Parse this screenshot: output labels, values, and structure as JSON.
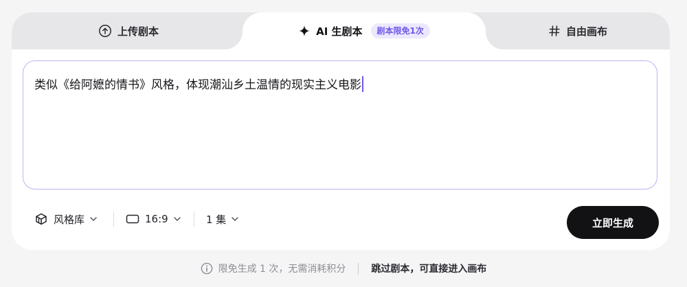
{
  "tabs": {
    "upload": {
      "label": "上传剧本",
      "icon": "upload-circle-icon"
    },
    "ai": {
      "label": "AI 生剧本",
      "icon": "sparkle-icon",
      "badge": "剧本限免1次"
    },
    "free": {
      "label": "自由画布",
      "icon": "hash-icon"
    }
  },
  "prompt": {
    "value": "类似《给阿嬷的情书》风格，体现潮汕乡土温情的现实主义电影"
  },
  "toolbar": {
    "style_library": {
      "label": "风格库",
      "icon": "style-library-icon"
    },
    "aspect_ratio": {
      "label": "16:9",
      "icon": "rectangle-icon"
    },
    "episodes": {
      "label": "1 集"
    },
    "generate_label": "立即生成"
  },
  "footer": {
    "note": "限免生成 1 次，无需消耗积分",
    "skip_link": "跳过剧本，可直接进入画布"
  },
  "colors": {
    "accent": "#6d58e8",
    "badge_bg": "#ece8ff",
    "textarea_border": "#bdb2f6",
    "button_bg": "#121214",
    "page_bg": "#f5f5f6"
  }
}
